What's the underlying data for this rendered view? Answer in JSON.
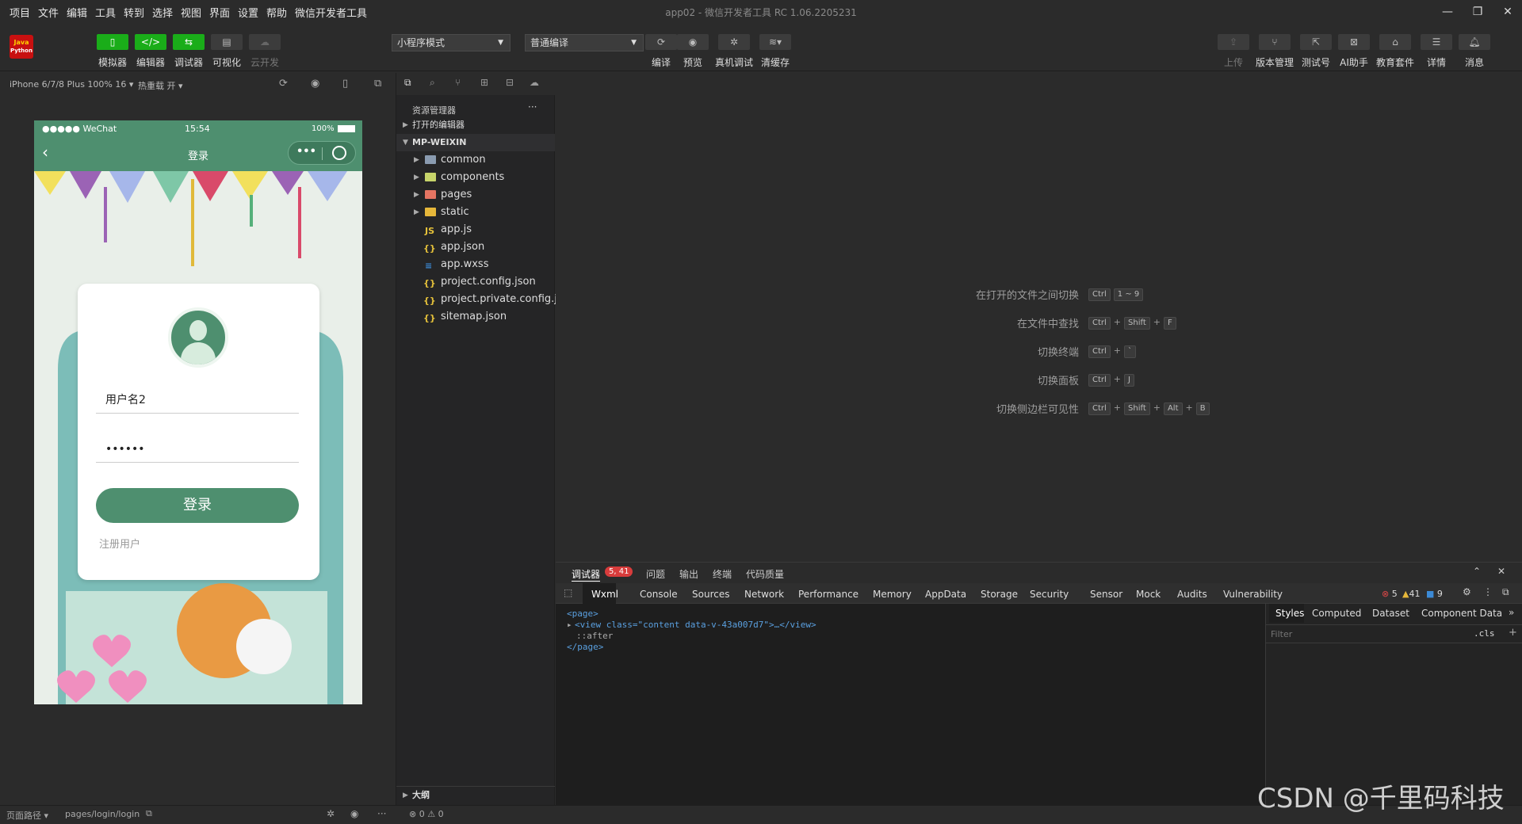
{
  "menu": [
    "项目",
    "文件",
    "编辑",
    "工具",
    "转到",
    "选择",
    "视图",
    "界面",
    "设置",
    "帮助",
    "微信开发者工具"
  ],
  "window_title": "app02 - 微信开发者工具 RC 1.06.2205231",
  "window_controls": {
    "minimize": "—",
    "restore": "❐",
    "close": "✕"
  },
  "logo": {
    "line1": "Java",
    "line2": "Python"
  },
  "toolbar": {
    "simulator": "模拟器",
    "editor": "编辑器",
    "debugger": "调试器",
    "visualize": "可视化",
    "cloud": "云开发",
    "mode_select": "小程序模式",
    "compile_select": "普通编译",
    "compile": "编译",
    "preview": "预览",
    "real_debug": "真机调试",
    "clear_cache": "清缓存",
    "upload": "上传",
    "version": "版本管理",
    "test_account": "测试号",
    "ai": "AI助手",
    "edu": "教育套件",
    "details": "详情",
    "messages": "消息"
  },
  "sim_bar": {
    "device": "iPhone 6/7/8 Plus 100% 16",
    "hot_reload": "热重载 开"
  },
  "phone": {
    "carrier": "●●●●● WeChat",
    "time": "15:54",
    "battery": "100%",
    "nav_title": "登录",
    "capsule_more": "•••",
    "username_value": "用户名2",
    "password_value": "••••••",
    "login_button": "登录",
    "register_link": "注册用户"
  },
  "explorer": {
    "title": "资源管理器",
    "more": "···",
    "open_editors": "打开的编辑器",
    "project": "MP-WEIXIN",
    "folders": [
      "common",
      "components",
      "pages",
      "static"
    ],
    "files": [
      "app.js",
      "app.json",
      "app.wxss",
      "project.config.json",
      "project.private.config.js...",
      "sitemap.json"
    ],
    "outline": "大纲"
  },
  "shortcuts": [
    {
      "label": "在打开的文件之间切换",
      "keys": [
        "Ctrl",
        "1 ~ 9"
      ]
    },
    {
      "label": "在文件中查找",
      "keys": [
        "Ctrl",
        "Shift",
        "F"
      ]
    },
    {
      "label": "切换终端",
      "keys": [
        "Ctrl",
        "`"
      ]
    },
    {
      "label": "切换面板",
      "keys": [
        "Ctrl",
        "J"
      ]
    },
    {
      "label": "切换侧边栏可见性",
      "keys": [
        "Ctrl",
        "Shift",
        "Alt",
        "B"
      ]
    }
  ],
  "devtools": {
    "top_tabs": [
      "调试器",
      "问题",
      "输出",
      "终端",
      "代码质量"
    ],
    "badge": "5, 41",
    "tabs": [
      "Wxml",
      "Console",
      "Sources",
      "Network",
      "Performance",
      "Memory",
      "AppData",
      "Storage",
      "Security",
      "Sensor",
      "Mock",
      "Audits",
      "Vulnerability"
    ],
    "errors": "5",
    "warnings": "41",
    "infos": "9",
    "side_tabs": [
      "Styles",
      "Computed",
      "Dataset",
      "Component Data"
    ],
    "filter_placeholder": "Filter",
    "cls": ".cls",
    "code": [
      "<page>",
      "<view class=\"content data-v-43a007d7\">…</view>",
      "::after",
      "</page>"
    ]
  },
  "status": {
    "page_path_label": "页面路径",
    "page_path": "pages/login/login",
    "errors": "0",
    "warnings": "0"
  },
  "watermark": "CSDN @千里码科技",
  "colors": {
    "accent": "#1aad19",
    "phone_green": "#4e8f6f"
  }
}
